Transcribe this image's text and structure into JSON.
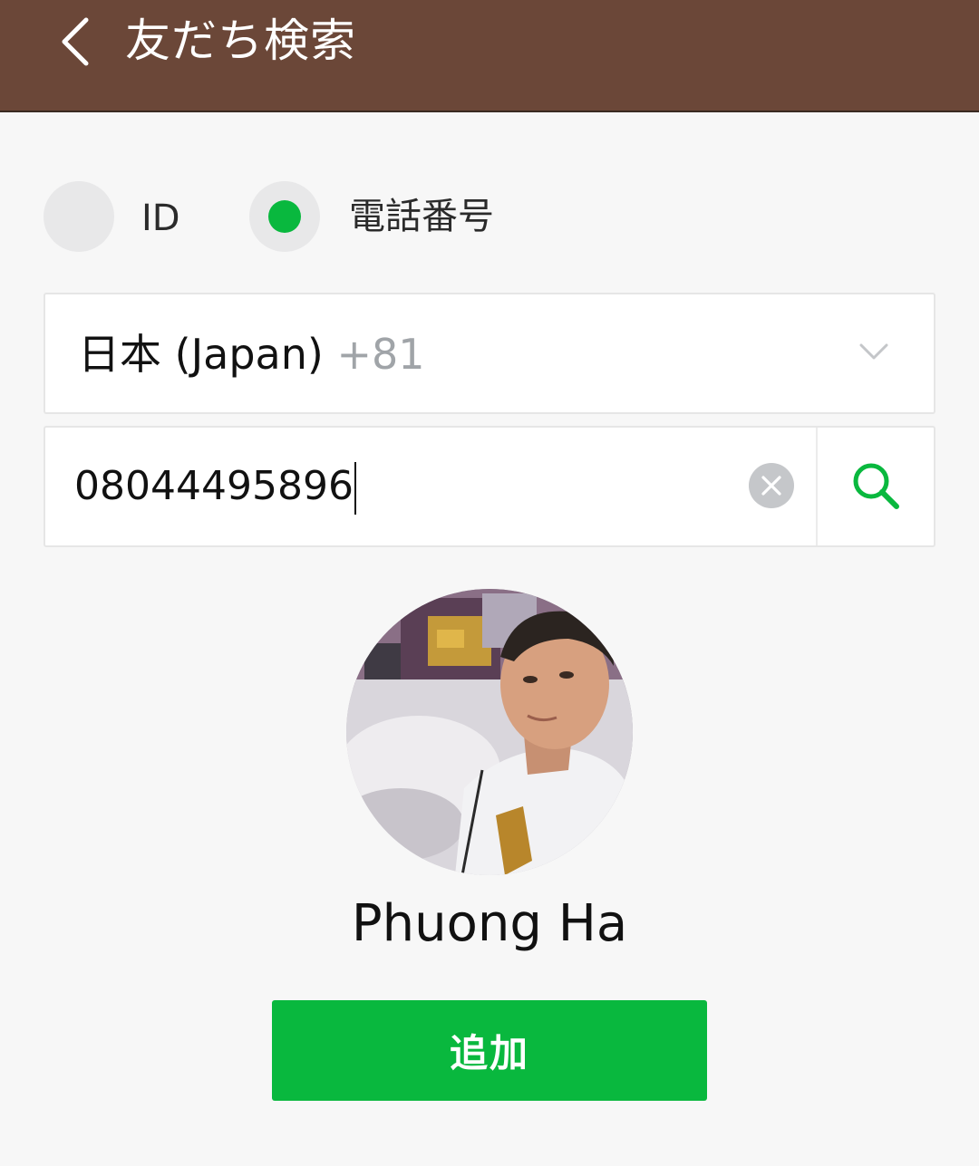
{
  "header": {
    "title": "友だち検索",
    "back_icon": "chevron-left-icon"
  },
  "search_type": {
    "options": [
      {
        "label": "ID",
        "selected": false
      },
      {
        "label": "電話番号",
        "selected": true
      }
    ]
  },
  "country": {
    "name": "日本 (Japan)",
    "code": "+81",
    "dropdown_icon": "chevron-down-icon"
  },
  "phone": {
    "value": "08044495896",
    "clear_icon": "clear-icon",
    "search_icon": "search-icon"
  },
  "result": {
    "name": "Phuong Ha",
    "add_label": "追加"
  },
  "colors": {
    "header_bg": "#6b4738",
    "accent": "#09b83e",
    "background": "#f7f7f7"
  }
}
